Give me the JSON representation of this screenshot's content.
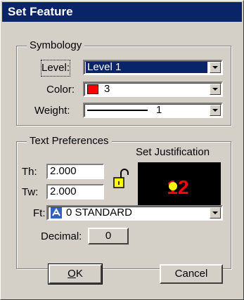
{
  "window": {
    "title": "Set Feature"
  },
  "symbology": {
    "group_title": "Symbology",
    "level_label": "Level:",
    "level_value": "Level 1",
    "color_label": "Color:",
    "color_value": "3",
    "color_swatch": "#ff0000",
    "weight_label": "Weight:",
    "weight_value": "1"
  },
  "text_prefs": {
    "group_title": "Text Preferences",
    "justification_label": "Set Justification",
    "preview_text": "12",
    "th_label": "Th:",
    "th_value": "2.000",
    "tw_label": "Tw:",
    "tw_value": "2.000",
    "lock_icon": "lock-open-icon",
    "ft_label": "Ft:",
    "ft_value": "0 STANDARD",
    "font_icon": "font-icon",
    "decimal_label": "Decimal:",
    "decimal_value": "0"
  },
  "buttons": {
    "ok_prefix": "O",
    "ok_underline": "K",
    "cancel": "Cancel"
  },
  "colors": {
    "title_bar": "#0a246a",
    "preview_digits": "#ff0000",
    "preview_dot": "#ffff00"
  }
}
